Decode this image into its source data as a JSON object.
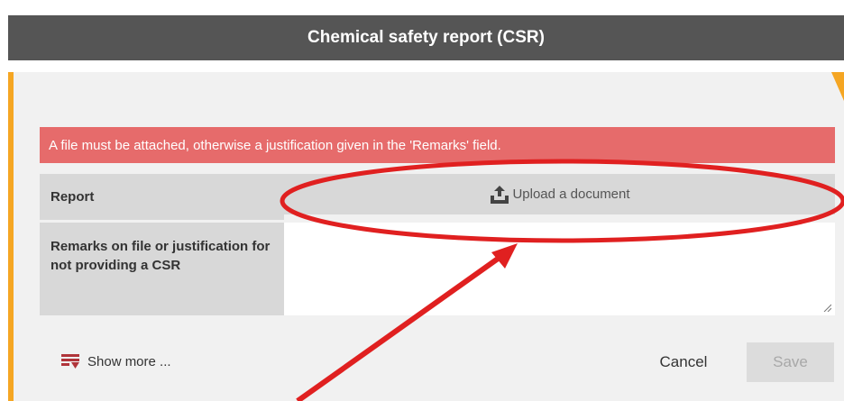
{
  "header": {
    "title": "Chemical safety report (CSR)"
  },
  "alert": {
    "message": "A file must be attached, otherwise a justification given in the 'Remarks' field."
  },
  "form": {
    "report_label": "Report",
    "upload_label": "Upload a document",
    "remarks_label": "Remarks on file or justification for not providing a CSR",
    "remarks_value": ""
  },
  "footer": {
    "show_more_label": "Show more ...",
    "cancel_label": "Cancel",
    "save_label": "Save"
  },
  "colors": {
    "header_bg": "#555555",
    "accent": "#f5a623",
    "error_bg": "#e66b6b",
    "annotation": "#e02020"
  },
  "icons": {
    "upload": "upload-icon",
    "show_more": "show-more-icon",
    "resize": "resize-grip-icon"
  }
}
